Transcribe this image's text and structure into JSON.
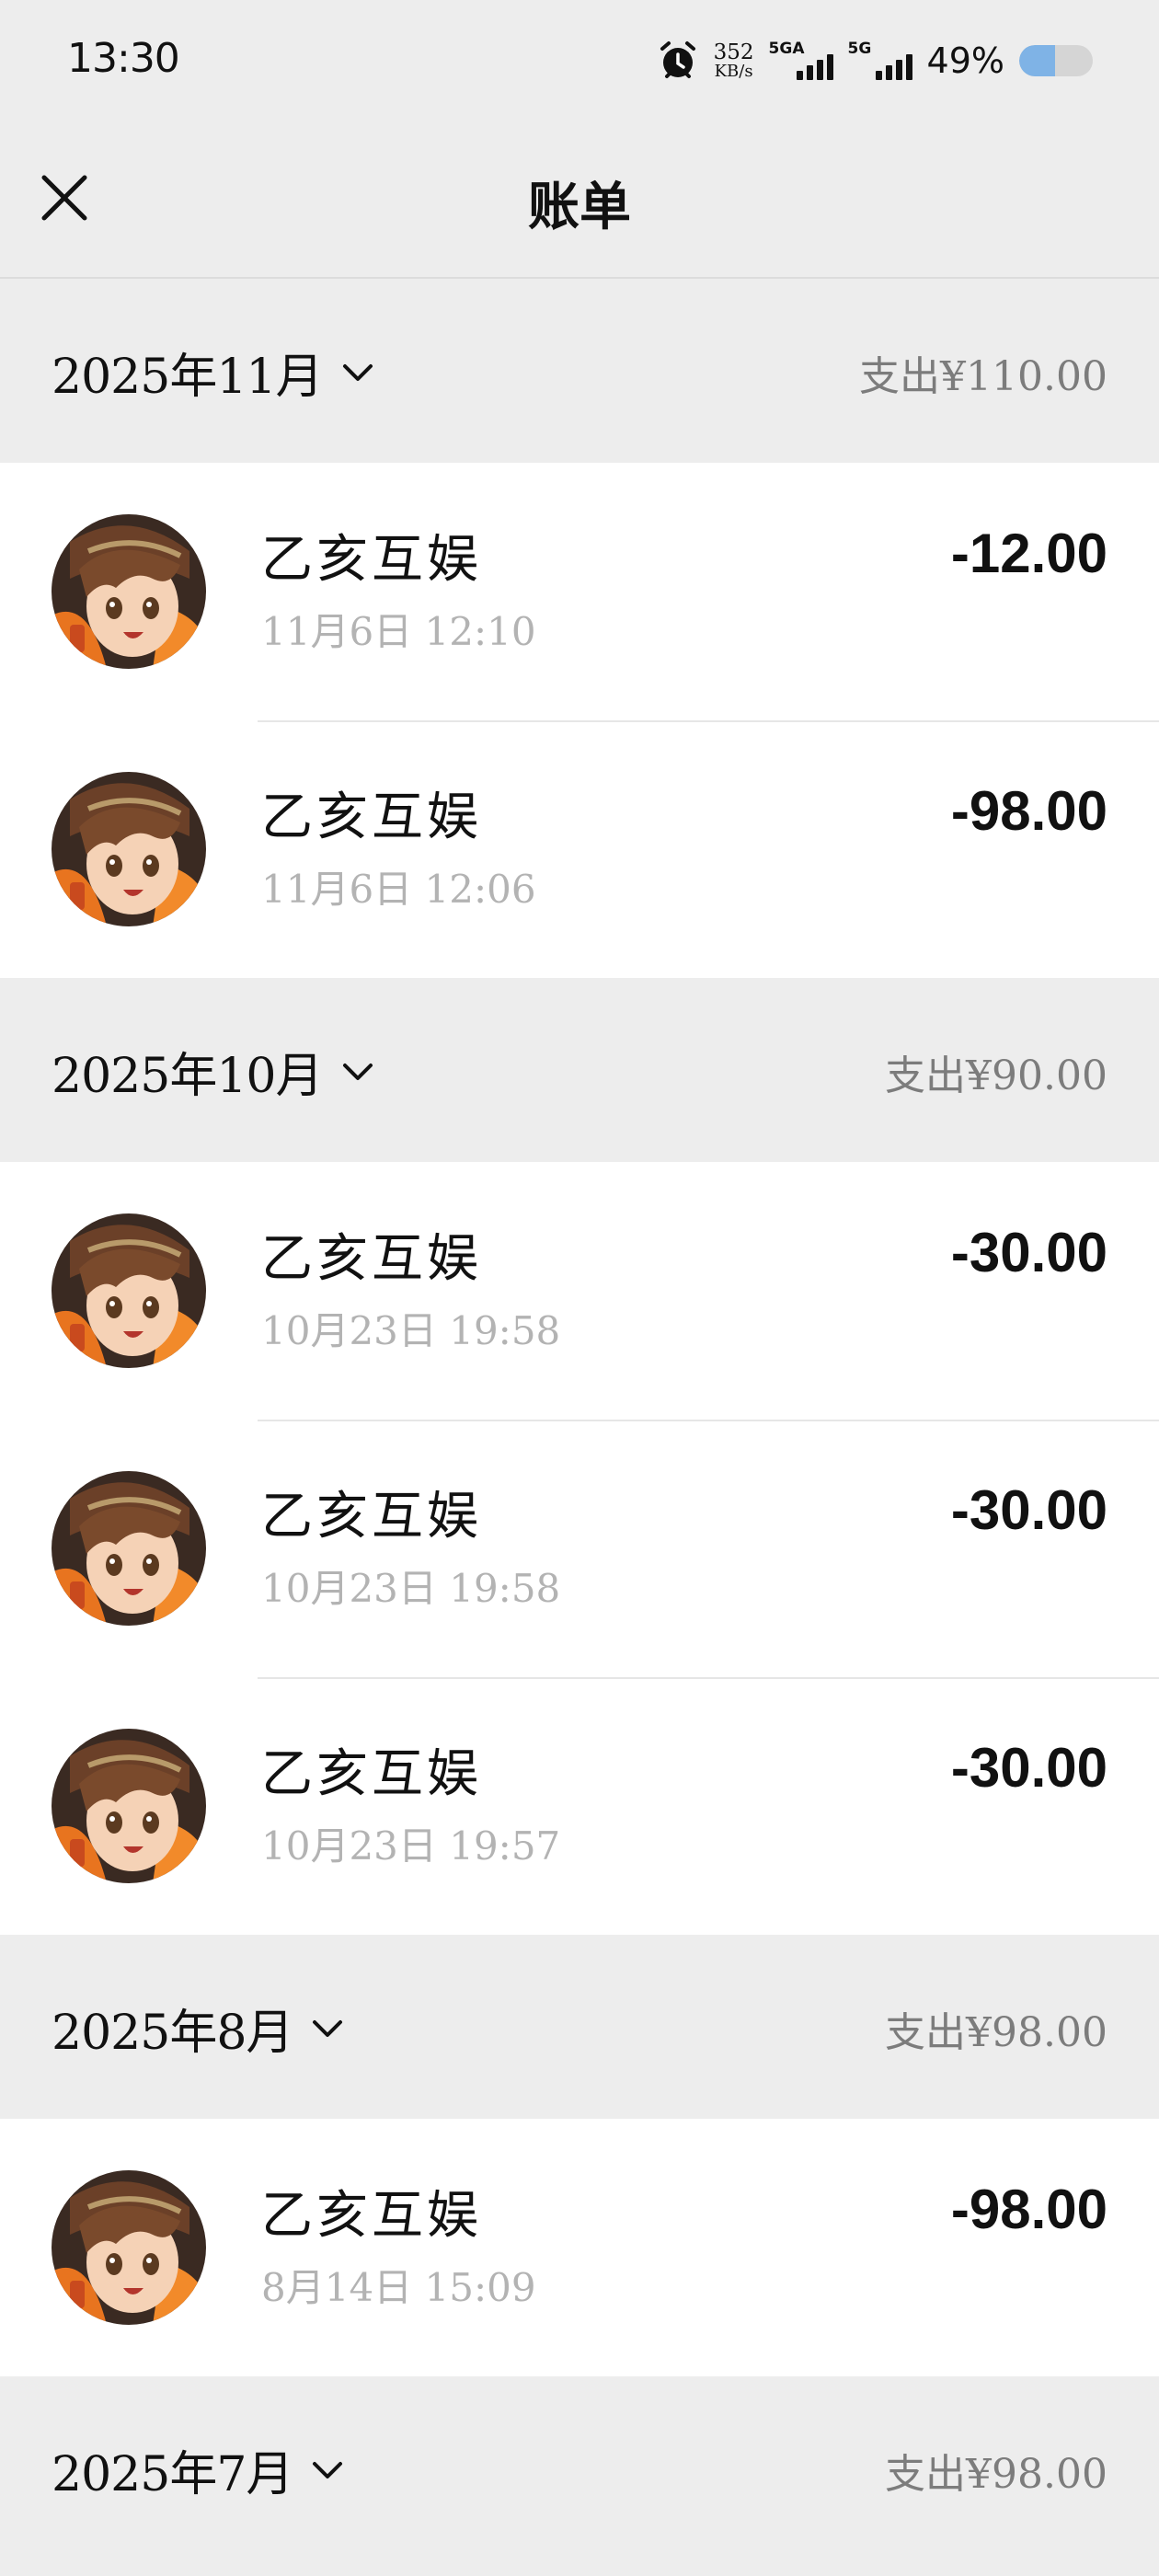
{
  "status_bar": {
    "time": "13:30",
    "net_speed_value": "352",
    "net_speed_unit": "KB/s",
    "signal_1_label": "5GA",
    "signal_2_label": "5G",
    "battery_percent": "49%",
    "battery_level": 0.49
  },
  "header": {
    "title": "账单",
    "close_icon": "close-icon"
  },
  "sections": [
    {
      "month": "2025年11月",
      "total": "支出¥110.00",
      "items": [
        {
          "name": "乙亥互娱",
          "time": "11月6日 12:10",
          "amount": "-12.00"
        },
        {
          "name": "乙亥互娱",
          "time": "11月6日 12:06",
          "amount": "-98.00"
        }
      ]
    },
    {
      "month": "2025年10月",
      "total": "支出¥90.00",
      "items": [
        {
          "name": "乙亥互娱",
          "time": "10月23日 19:58",
          "amount": "-30.00"
        },
        {
          "name": "乙亥互娱",
          "time": "10月23日 19:58",
          "amount": "-30.00"
        },
        {
          "name": "乙亥互娱",
          "time": "10月23日 19:57",
          "amount": "-30.00"
        }
      ]
    },
    {
      "month": "2025年8月",
      "total": "支出¥98.00",
      "items": [
        {
          "name": "乙亥互娱",
          "time": "8月14日 15:09",
          "amount": "-98.00"
        }
      ]
    },
    {
      "month": "2025年7月",
      "total": "支出¥98.00",
      "items": []
    }
  ],
  "colors": {
    "background": "#ededed",
    "card": "#ffffff",
    "secondary_text": "#b3b3b3",
    "total_text": "#7c7c7c",
    "battery_fill": "#7fb3e6"
  }
}
